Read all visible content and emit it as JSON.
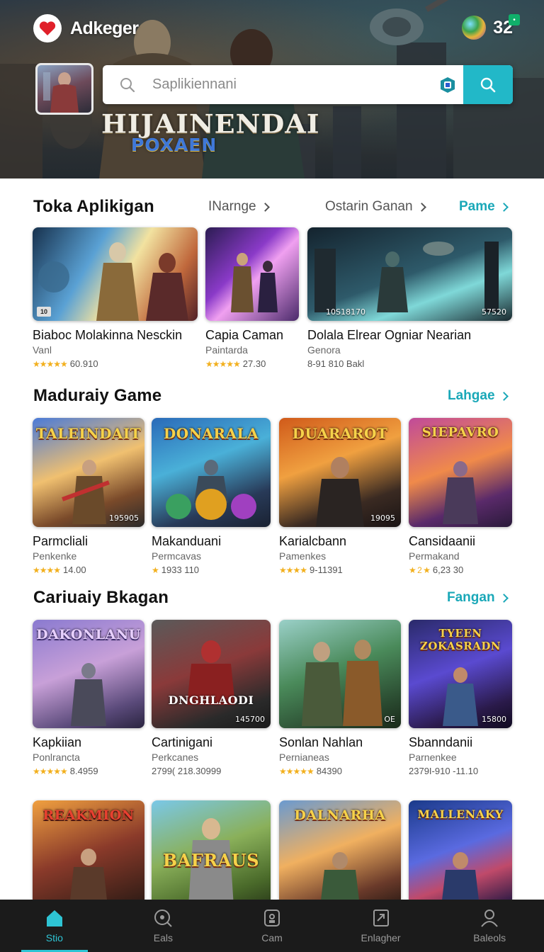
{
  "header": {
    "app_name": "Adkeger",
    "coins": "32",
    "search_placeholder": "Saplikiennani",
    "hero_title": "HIJAINENDAI",
    "hero_subtitle": "POXAEN"
  },
  "sections": [
    {
      "title": "Toka Aplikigan",
      "links": [
        "INarnge",
        "Ostarin Ganan"
      ],
      "action": "Pame",
      "cards": [
        {
          "title": "Biaboc Molakinna Nesckin",
          "sub": "Vanl",
          "stars": "★★★★★",
          "rating": "60.910",
          "badge": "10",
          "stat": ""
        },
        {
          "title": "Capia Caman",
          "sub": "Paintarda",
          "stars": "★★★★★",
          "rating": "27.30",
          "badge": "",
          "stat": ""
        },
        {
          "title": "Dolala Elrear Ogniar Nearian",
          "sub": "Genora",
          "stars": "",
          "rating": "8-91 810 Bakl",
          "badge": "",
          "stat": "57520",
          "stat_left": "10S18170"
        }
      ]
    },
    {
      "title": "Maduraiy Game",
      "action": "Lahgae",
      "cards": [
        {
          "title": "Parmcliali",
          "sub": "Penkenke",
          "stars": "★★★★",
          "rating": "14.00",
          "stat": "195905",
          "art": "TALEINDAIT"
        },
        {
          "title": "Makanduani",
          "sub": "Permcavas",
          "stars": "★",
          "rating": "1933 110",
          "stat": "",
          "art": "DONARALA"
        },
        {
          "title": "Karialcbann",
          "sub": "Pamenkes",
          "stars": "★★★★",
          "rating": "9-11391",
          "stat": "19095",
          "art": "DUARAROT"
        },
        {
          "title": "Cansidaanii",
          "sub": "Permakand",
          "stars": "★ 2 ★",
          "rating": "6,23 30",
          "stat": "",
          "art": "SIEPAVRO"
        }
      ]
    },
    {
      "title": "Cariuaiy Bkagan",
      "action": "Fangan",
      "cards": [
        {
          "title": "Kapkiian",
          "sub": "Ponlrancta",
          "stars": "★★★★★",
          "rating": "8.4959",
          "stat": "",
          "art": "DAKONLANU"
        },
        {
          "title": "Cartinigani",
          "sub": "Perkcanes",
          "stars": "",
          "rating": "2799( 218.30999",
          "stat": "145700",
          "art": "DNGHLAODI"
        },
        {
          "title": "Sonlan Nahlan",
          "sub": "Pernianeas",
          "stars": "★★★★★",
          "rating": "84390",
          "stat": "OE",
          "art": ""
        },
        {
          "title": "Sbanndanii",
          "sub": "Parnenkee",
          "stars": "",
          "rating": "2379I-910 -11.10",
          "stat": "15800",
          "art": "TYEEN ZOKASRADN"
        }
      ]
    },
    {
      "title": "",
      "cards": [
        {
          "art": "REAKMION"
        },
        {
          "art": "BAFRAUS"
        },
        {
          "art": "DALNARHA"
        },
        {
          "art": "MALLENAKY"
        }
      ]
    }
  ],
  "bottom_nav": [
    {
      "label": "Stio",
      "icon": "home-icon",
      "active": true
    },
    {
      "label": "Eals",
      "icon": "search-icon",
      "active": false
    },
    {
      "label": "Cam",
      "icon": "camera-icon",
      "active": false
    },
    {
      "label": "Enlagher",
      "icon": "share-icon",
      "active": false
    },
    {
      "label": "Baleols",
      "icon": "profile-icon",
      "active": false
    }
  ],
  "colors": {
    "accent": "#1aa8b8",
    "nav_background": "#1b1b1b",
    "star": "#f2b01e"
  }
}
